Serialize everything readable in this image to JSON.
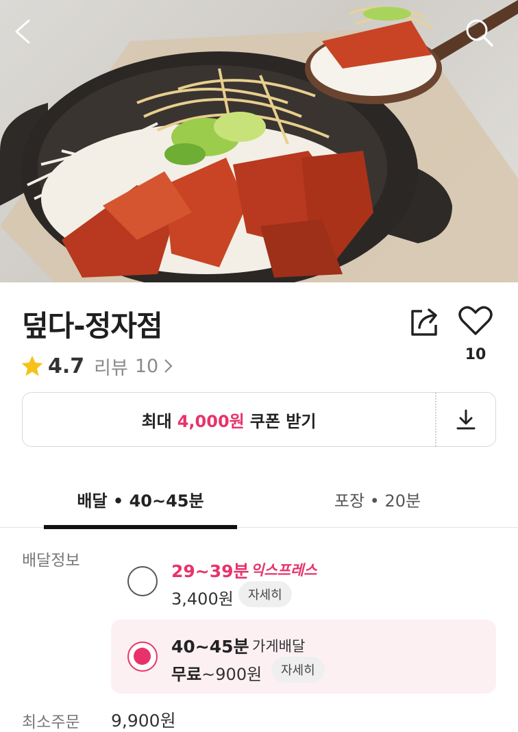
{
  "store": {
    "name": "덮다-정자점",
    "rating": "4.7",
    "review_label": "리뷰",
    "review_count": "10",
    "like_count": "10"
  },
  "coupon": {
    "prefix": "최대",
    "amount": "4,000원",
    "suffix": "쿠폰 받기"
  },
  "tabs": [
    {
      "label": "배달 • 40~45분",
      "active": true
    },
    {
      "label": "포장 • 20분",
      "active": false
    }
  ],
  "delivery_info": {
    "label": "배달정보",
    "options": [
      {
        "time": "29~39분",
        "badge": "익스프레스",
        "fee": "3,400원",
        "detail": "자세히",
        "selected": false
      },
      {
        "time": "40~45분",
        "type": "가게배달",
        "fee_free": "무료",
        "fee_range": "~900원",
        "detail": "자세히",
        "selected": true
      }
    ]
  },
  "min_order": {
    "label": "최소주문",
    "value": "9,900원"
  },
  "icons": {
    "back": "back-arrow-icon",
    "search": "search-icon",
    "share": "share-icon",
    "like": "heart-icon",
    "star": "star-icon",
    "download": "download-icon"
  },
  "colors": {
    "accent": "#e8336a",
    "star": "#f6c21a"
  }
}
